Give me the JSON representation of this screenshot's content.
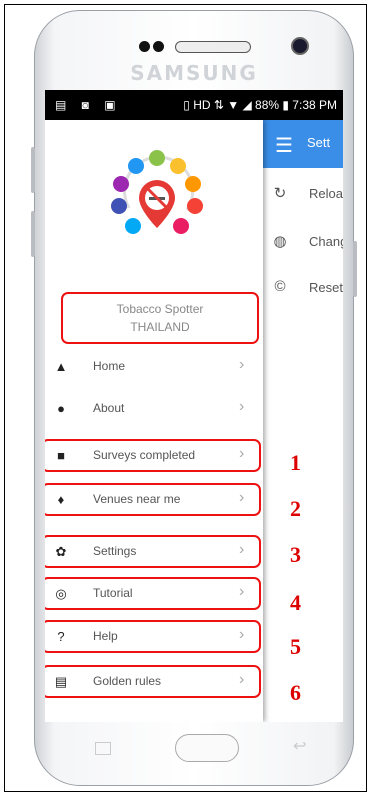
{
  "device": {
    "brand": "SAMSUNG"
  },
  "status_bar": {
    "left_icons": "▤ ◙ ▣",
    "right_text": "▯ HD ⇅ ▼ ◢ 88% ▮ 7:38 PM",
    "battery": "88%",
    "time": "7:38 PM"
  },
  "app_behind": {
    "title": "Sett",
    "menu_icon": "hamburger-icon",
    "rows": [
      {
        "icon": "reload-icon",
        "label": "Reload"
      },
      {
        "icon": "globe-icon",
        "label": "Chang"
      },
      {
        "icon": "reset-icon",
        "label": "Reset"
      }
    ]
  },
  "drawer": {
    "org_name": "Tobacco Spotter",
    "org_country": "THAILAND",
    "items": [
      {
        "label": "Home",
        "icon": "home-icon"
      },
      {
        "label": "About",
        "icon": "info-icon"
      },
      {
        "label": "Surveys completed",
        "icon": "briefcase-icon"
      },
      {
        "label": "Venues near me",
        "icon": "map-pin-icon"
      },
      {
        "label": "Settings",
        "icon": "gear-icon"
      },
      {
        "label": "Tutorial",
        "icon": "tutorial-icon"
      },
      {
        "label": "Help",
        "icon": "help-icon"
      },
      {
        "label": "Golden rules",
        "icon": "clipboard-icon"
      }
    ]
  },
  "annotations": [
    "1",
    "2",
    "3",
    "4",
    "5",
    "6"
  ],
  "colors": {
    "app_bar": "#3b8ee8",
    "highlight": "#e11111",
    "annotation": "#dd0000"
  }
}
